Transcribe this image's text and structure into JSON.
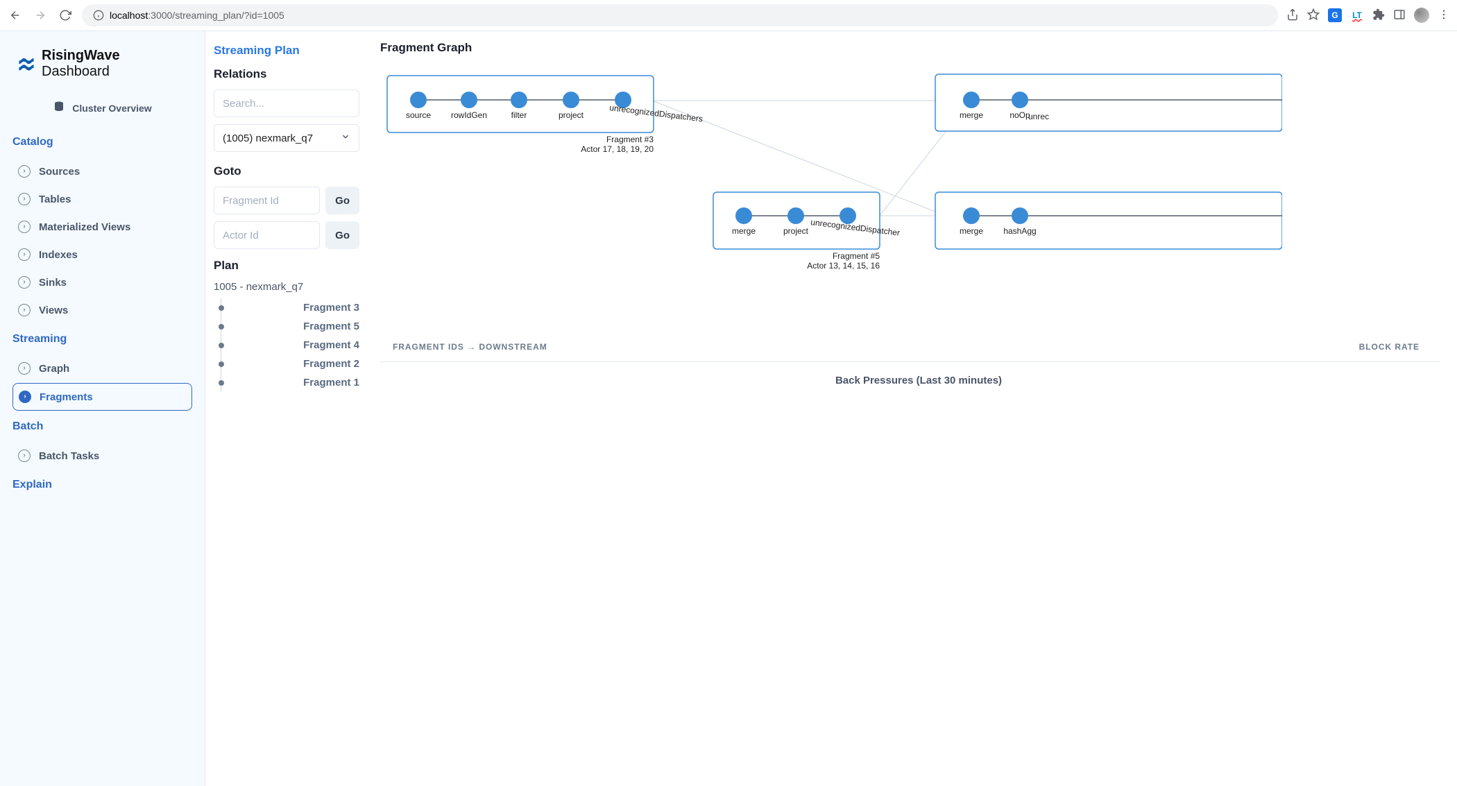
{
  "browser": {
    "url_prefix": "localhost",
    "url_rest": ":3000/streaming_plan/?id=1005",
    "ext_lt": "LT"
  },
  "brand": {
    "bold": "RisingWave",
    "rest": " Dashboard"
  },
  "cluster_overview": "Cluster Overview",
  "sections": {
    "catalog": "Catalog",
    "streaming": "Streaming",
    "batch": "Batch",
    "explain": "Explain"
  },
  "nav": {
    "sources": "Sources",
    "tables": "Tables",
    "mviews": "Materialized Views",
    "indexes": "Indexes",
    "sinks": "Sinks",
    "views": "Views",
    "graph": "Graph",
    "fragments": "Fragments",
    "batch_tasks": "Batch Tasks"
  },
  "page_title": "Streaming Plan",
  "relations": {
    "heading": "Relations",
    "search_ph": "Search...",
    "selected": "(1005) nexmark_q7"
  },
  "goto": {
    "heading": "Goto",
    "fragment_ph": "Fragment Id",
    "actor_ph": "Actor Id",
    "go": "Go"
  },
  "plan": {
    "heading": "Plan",
    "name": "1005 - nexmark_q7",
    "fragments": [
      "Fragment 3",
      "Fragment 5",
      "Fragment 4",
      "Fragment 2",
      "Fragment 1"
    ]
  },
  "graph": {
    "heading": "Fragment Graph",
    "frag3": {
      "caption1": "Fragment #3",
      "caption2": "Actor 17, 18, 19, 20",
      "nodes": [
        "source",
        "rowIdGen",
        "filter",
        "project",
        "unrecognizedDispatchers"
      ]
    },
    "frag5": {
      "caption1": "Fragment #5",
      "caption2": "Actor 13, 14, 15, 16",
      "nodes": [
        "merge",
        "project",
        "unrecognizedDispatcher"
      ]
    },
    "right_top": {
      "nodes": [
        "merge",
        "noOp",
        "unrec"
      ]
    },
    "right_bottom": {
      "nodes": [
        "merge",
        "hashAgg"
      ]
    }
  },
  "table": {
    "col1": "FRAGMENT IDS → DOWNSTREAM",
    "col2": "BLOCK RATE",
    "bp": "Back Pressures (Last 30 minutes)"
  }
}
